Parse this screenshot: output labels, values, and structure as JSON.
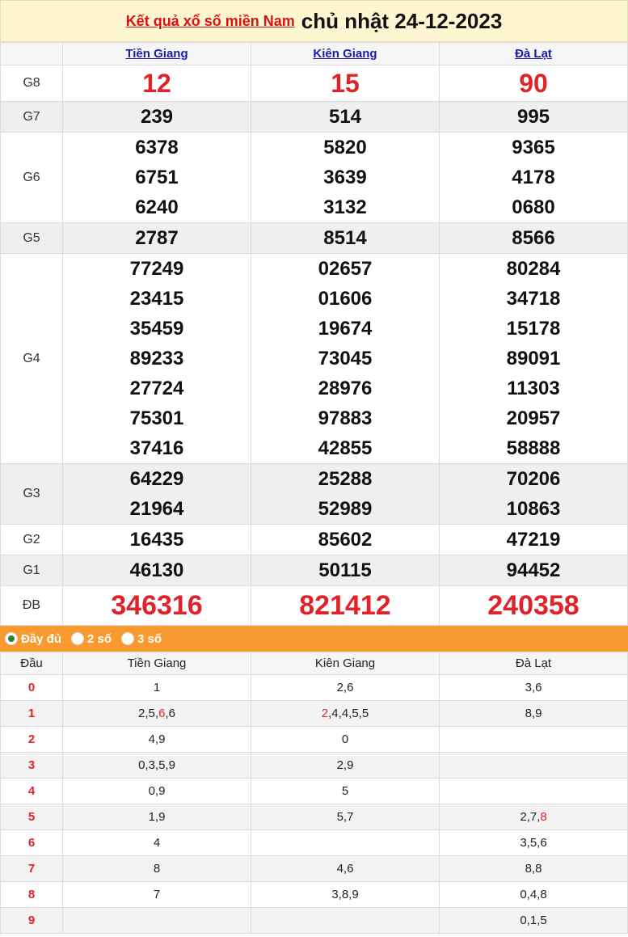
{
  "header": {
    "link_text": "Kết quả xổ số miền Nam",
    "date_text": "chủ nhật 24-12-2023"
  },
  "provinces": [
    "Tiền Giang",
    "Kiên Giang",
    "Đà Lạt"
  ],
  "prizes": [
    {
      "label": "G8",
      "values": [
        [
          "12"
        ],
        [
          "15"
        ],
        [
          "90"
        ]
      ]
    },
    {
      "label": "G7",
      "values": [
        [
          "239"
        ],
        [
          "514"
        ],
        [
          "995"
        ]
      ]
    },
    {
      "label": "G6",
      "values": [
        [
          "6378",
          "6751",
          "6240"
        ],
        [
          "5820",
          "3639",
          "3132"
        ],
        [
          "9365",
          "4178",
          "0680"
        ]
      ]
    },
    {
      "label": "G5",
      "values": [
        [
          "2787"
        ],
        [
          "8514"
        ],
        [
          "8566"
        ]
      ]
    },
    {
      "label": "G4",
      "values": [
        [
          "77249",
          "23415",
          "35459",
          "89233",
          "27724",
          "75301",
          "37416"
        ],
        [
          "02657",
          "01606",
          "19674",
          "73045",
          "28976",
          "97883",
          "42855"
        ],
        [
          "80284",
          "34718",
          "15178",
          "89091",
          "11303",
          "20957",
          "58888"
        ]
      ]
    },
    {
      "label": "G3",
      "values": [
        [
          "64229",
          "21964"
        ],
        [
          "25288",
          "52989"
        ],
        [
          "70206",
          "10863"
        ]
      ]
    },
    {
      "label": "G2",
      "values": [
        [
          "16435"
        ],
        [
          "85602"
        ],
        [
          "47219"
        ]
      ]
    },
    {
      "label": "G1",
      "values": [
        [
          "46130"
        ],
        [
          "50115"
        ],
        [
          "94452"
        ]
      ]
    },
    {
      "label": "ĐB",
      "values": [
        [
          "346316"
        ],
        [
          "821412"
        ],
        [
          "240358"
        ]
      ]
    }
  ],
  "options": {
    "full": "Đầy đủ",
    "two": "2 số",
    "three": "3 số"
  },
  "loto": {
    "head_label": "Đầu",
    "rows": [
      {
        "dau": "0",
        "cells": [
          [
            {
              "t": "1"
            }
          ],
          [
            {
              "t": "2,6"
            }
          ],
          [
            {
              "t": "3,6"
            }
          ]
        ]
      },
      {
        "dau": "1",
        "cells": [
          [
            {
              "t": "2,5,"
            },
            {
              "t": "6",
              "r": true
            },
            {
              "t": ",6"
            }
          ],
          [
            {
              "t": "2",
              "r": true
            },
            {
              "t": ",4,4,5,5"
            }
          ],
          [
            {
              "t": "8,9"
            }
          ]
        ]
      },
      {
        "dau": "2",
        "cells": [
          [
            {
              "t": "4,9"
            }
          ],
          [
            {
              "t": "0"
            }
          ],
          []
        ]
      },
      {
        "dau": "3",
        "cells": [
          [
            {
              "t": "0,3,5,9"
            }
          ],
          [
            {
              "t": "2,9"
            }
          ],
          []
        ]
      },
      {
        "dau": "4",
        "cells": [
          [
            {
              "t": "0,9"
            }
          ],
          [
            {
              "t": "5"
            }
          ],
          []
        ]
      },
      {
        "dau": "5",
        "cells": [
          [
            {
              "t": "1,9"
            }
          ],
          [
            {
              "t": "5,7"
            }
          ],
          [
            {
              "t": "2,7,"
            },
            {
              "t": "8",
              "r": true
            }
          ]
        ]
      },
      {
        "dau": "6",
        "cells": [
          [
            {
              "t": "4"
            }
          ],
          [],
          [
            {
              "t": "3,5,6"
            }
          ]
        ]
      },
      {
        "dau": "7",
        "cells": [
          [
            {
              "t": "8"
            }
          ],
          [
            {
              "t": "4,6"
            }
          ],
          [
            {
              "t": "8,8"
            }
          ]
        ]
      },
      {
        "dau": "8",
        "cells": [
          [
            {
              "t": "7"
            }
          ],
          [
            {
              "t": "3,8,9"
            }
          ],
          [
            {
              "t": "0,4,8"
            }
          ]
        ]
      },
      {
        "dau": "9",
        "cells": [
          [],
          [],
          [
            {
              "t": "0,1,5"
            }
          ]
        ]
      }
    ]
  },
  "colors": {
    "accent_red": "#e0232b",
    "option_bar": "#f99a31",
    "title_bg": "#fdf6d0",
    "link_blue": "#1a1ab0"
  }
}
